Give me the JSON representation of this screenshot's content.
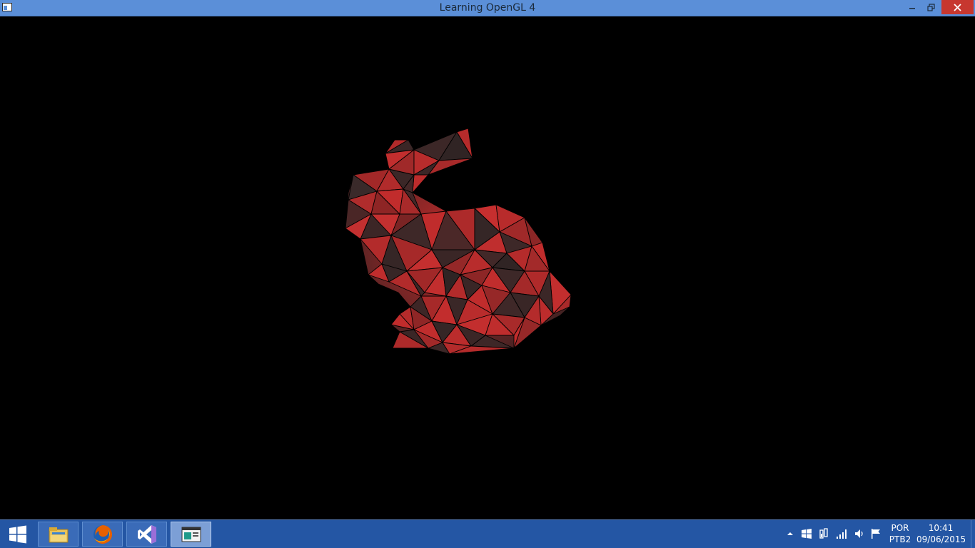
{
  "window": {
    "title": "Learning OpenGL 4",
    "icon": "window-app-icon",
    "controls": [
      "minimize-icon",
      "restore-icon",
      "close-icon"
    ]
  },
  "viewport": {
    "background": "#000000",
    "model": "stanford-bunny",
    "render_mode": "flat-shaded with wireframe edges",
    "mesh_color": "#c23232",
    "edge_color": "#000000"
  },
  "taskbar": {
    "start": "windows-logo-icon",
    "pinned": [
      {
        "name": "File Explorer",
        "icon": "file-explorer-icon"
      },
      {
        "name": "Firefox",
        "icon": "firefox-icon"
      },
      {
        "name": "Visual Studio",
        "icon": "visual-studio-icon"
      },
      {
        "name": "Learning OpenGL 4",
        "icon": "console-window-icon",
        "active": true
      }
    ],
    "tray": {
      "icons": [
        "show-hidden-icons-chevron",
        "windows-logo-tray-icon",
        "power-plug-icon",
        "network-signal-icon",
        "volume-icon",
        "action-center-flag-icon"
      ],
      "lang_line1": "POR",
      "lang_line2": "PTB2",
      "time": "10:41",
      "date": "09/06/2015"
    }
  },
  "colors": {
    "titlebar": "#5b8fd8",
    "close_button": "#c7372f",
    "taskbar": "#2456a4"
  }
}
